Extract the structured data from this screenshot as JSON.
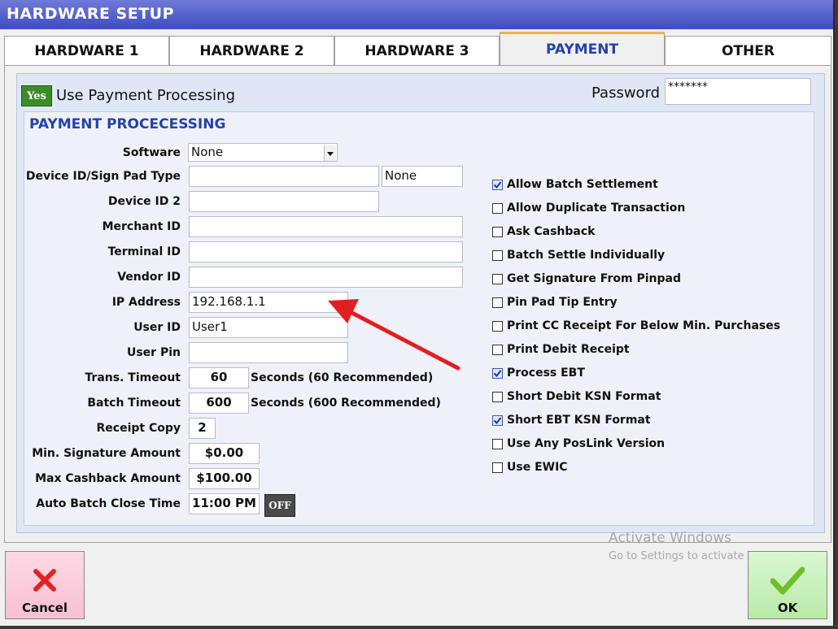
{
  "window": {
    "title": "HARDWARE SETUP"
  },
  "tabs": [
    {
      "label": "HARDWARE 1",
      "active": false
    },
    {
      "label": "HARDWARE 2",
      "active": false
    },
    {
      "label": "HARDWARE 3",
      "active": false
    },
    {
      "label": "PAYMENT",
      "active": true
    },
    {
      "label": "OTHER",
      "active": false
    }
  ],
  "header": {
    "use_payment_toggle": "Yes",
    "use_payment_label": "Use Payment Processing",
    "password_label": "Password",
    "password_value": "*******"
  },
  "section_title": "PAYMENT PROCECESSING",
  "fields": {
    "software_label": "Software",
    "software_value": "None",
    "device_type_label": "Device ID/Sign Pad Type",
    "device_type_value": "",
    "device_type_secondary": "None",
    "device_id2_label": "Device ID 2",
    "device_id2_value": "",
    "merchant_id_label": "Merchant ID",
    "merchant_id_value": "",
    "terminal_id_label": "Terminal ID",
    "terminal_id_value": "",
    "vendor_id_label": "Vendor ID",
    "vendor_id_value": "",
    "ip_address_label": "IP Address",
    "ip_address_value": "192.168.1.1",
    "user_id_label": "User ID",
    "user_id_value": "User1",
    "user_pin_label": "User Pin",
    "user_pin_value": "",
    "trans_timeout_label": "Trans. Timeout",
    "trans_timeout_value": "60",
    "trans_timeout_hint": "Seconds (60 Recommended)",
    "batch_timeout_label": "Batch Timeout",
    "batch_timeout_value": "600",
    "batch_timeout_hint": "Seconds (600 Recommended)",
    "receipt_copy_label": "Receipt Copy",
    "receipt_copy_value": "2",
    "min_signature_label": "Min. Signature Amount",
    "min_signature_value": "$0.00",
    "max_cashback_label": "Max Cashback Amount",
    "max_cashback_value": "$100.00",
    "auto_batch_label": "Auto Batch Close Time",
    "auto_batch_value": "11:00 PM",
    "auto_batch_toggle": "OFF"
  },
  "checkboxes": [
    {
      "label": "Allow Batch Settlement",
      "checked": true
    },
    {
      "label": "Allow Duplicate Transaction",
      "checked": false
    },
    {
      "label": "Ask Cashback",
      "checked": false
    },
    {
      "label": "Batch Settle Individually",
      "checked": false
    },
    {
      "label": "Get Signature From Pinpad",
      "checked": false
    },
    {
      "label": "Pin Pad Tip Entry",
      "checked": false
    },
    {
      "label": "Print CC Receipt For Below Min. Purchases",
      "checked": false
    },
    {
      "label": "Print Debit Receipt",
      "checked": false
    },
    {
      "label": "Process EBT",
      "checked": true
    },
    {
      "label": "Short Debit KSN Format",
      "checked": false
    },
    {
      "label": "Short EBT KSN Format",
      "checked": true
    },
    {
      "label": "Use Any PosLink Version",
      "checked": false
    },
    {
      "label": "Use EWIC",
      "checked": false
    }
  ],
  "footer": {
    "cancel_label": "Cancel",
    "ok_label": "OK",
    "watermark_title": "Activate Windows",
    "watermark_subtitle": "Go to Settings to activate Windows."
  },
  "colors": {
    "accent": "#2741a8",
    "titlebar": "#4a56c8",
    "annotation_arrow": "#e02020",
    "yes_badge": "#3c8d2a"
  }
}
